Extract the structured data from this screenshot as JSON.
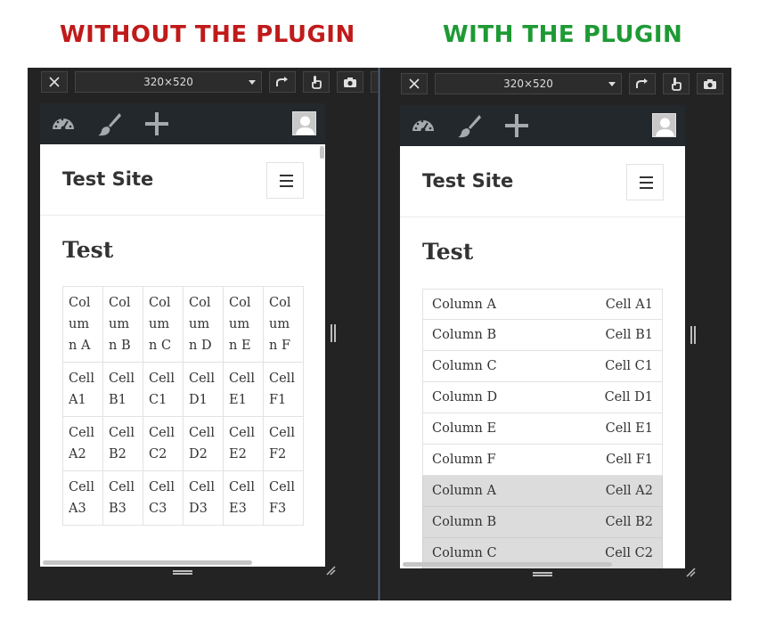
{
  "headings": {
    "without": "WITHOUT THE PLUGIN",
    "with": "WITH THE PLUGIN"
  },
  "colors": {
    "without_heading": "#c01a1a",
    "with_heading": "#1e9a34",
    "frame_bg": "#232323",
    "admin_bar": "#23282d",
    "shaded_row": "#dcdcdc"
  },
  "toolbar": {
    "close_icon": "close-icon",
    "size_value": "320×520",
    "rotate_icon": "rotate-icon",
    "touch_icon": "touch-icon",
    "screenshot_icon": "camera-icon"
  },
  "adminbar": {
    "icons": [
      "dashboard-icon",
      "brush-icon",
      "plus-icon",
      "avatar-icon"
    ]
  },
  "site": {
    "title": "Test Site",
    "page_title": "Test"
  },
  "without_table": {
    "headers": [
      "Column A",
      "Column B",
      "Column C",
      "Column D",
      "Column E",
      "Column F"
    ],
    "header_lines": [
      [
        "Col",
        "um",
        "n A"
      ],
      [
        "Col",
        "um",
        "n B"
      ],
      [
        "Col",
        "um",
        "n C"
      ],
      [
        "Col",
        "um",
        "n D"
      ],
      [
        "Col",
        "um",
        "n E"
      ],
      [
        "Col",
        "um",
        "n F"
      ]
    ],
    "rows": [
      [
        [
          "Cell",
          "A1"
        ],
        [
          "Cell",
          "B1"
        ],
        [
          "Cell",
          "C1"
        ],
        [
          "Cell",
          "D1"
        ],
        [
          "Cell",
          "E1"
        ],
        [
          "Cell",
          "F1"
        ]
      ],
      [
        [
          "Cell",
          "A2"
        ],
        [
          "Cell",
          "B2"
        ],
        [
          "Cell",
          "C2"
        ],
        [
          "Cell",
          "D2"
        ],
        [
          "Cell",
          "E2"
        ],
        [
          "Cell",
          "F2"
        ]
      ],
      [
        [
          "Cell",
          "A3"
        ],
        [
          "Cell",
          "B3"
        ],
        [
          "Cell",
          "C3"
        ],
        [
          "Cell",
          "D3"
        ],
        [
          "Cell",
          "E3"
        ],
        [
          "Cell",
          "F3"
        ]
      ]
    ]
  },
  "with_table": {
    "rows": [
      {
        "label": "Column A",
        "value": "Cell A1",
        "shaded": false
      },
      {
        "label": "Column B",
        "value": "Cell B1",
        "shaded": false
      },
      {
        "label": "Column C",
        "value": "Cell C1",
        "shaded": false
      },
      {
        "label": "Column D",
        "value": "Cell D1",
        "shaded": false
      },
      {
        "label": "Column E",
        "value": "Cell E1",
        "shaded": false
      },
      {
        "label": "Column F",
        "value": "Cell F1",
        "shaded": false
      },
      {
        "label": "Column A",
        "value": "Cell A2",
        "shaded": true
      },
      {
        "label": "Column B",
        "value": "Cell B2",
        "shaded": true
      },
      {
        "label": "Column C",
        "value": "Cell C2",
        "shaded": true
      }
    ]
  }
}
